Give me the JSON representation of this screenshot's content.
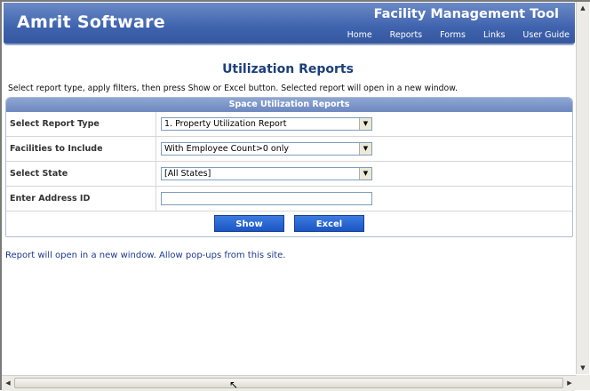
{
  "header": {
    "brand": "Amrit Software",
    "tool_title": "Facility Management Tool",
    "nav": [
      "Home",
      "Reports",
      "Forms",
      "Links",
      "User Guide"
    ]
  },
  "page": {
    "title": "Utilization Reports",
    "instructions": "Select report type, apply filters, then press Show or Excel button. Selected report will open in a new window.",
    "note": "Report will open in a new window. Allow pop-ups from this site."
  },
  "panel": {
    "heading": "Space Utilization Reports",
    "rows": [
      {
        "label": "Select Report Type",
        "value": "1. Property Utilization Report"
      },
      {
        "label": "Facilities to Include",
        "value": "With Employee Count>0 only"
      },
      {
        "label": "Select State",
        "value": "[All States]"
      },
      {
        "label": "Enter Address ID",
        "value": ""
      }
    ],
    "show_label": "Show",
    "excel_label": "Excel"
  },
  "colors": {
    "header_blue": "#3f63ae",
    "title_blue": "#1c3f7a",
    "button_blue": "#1b56c4"
  }
}
